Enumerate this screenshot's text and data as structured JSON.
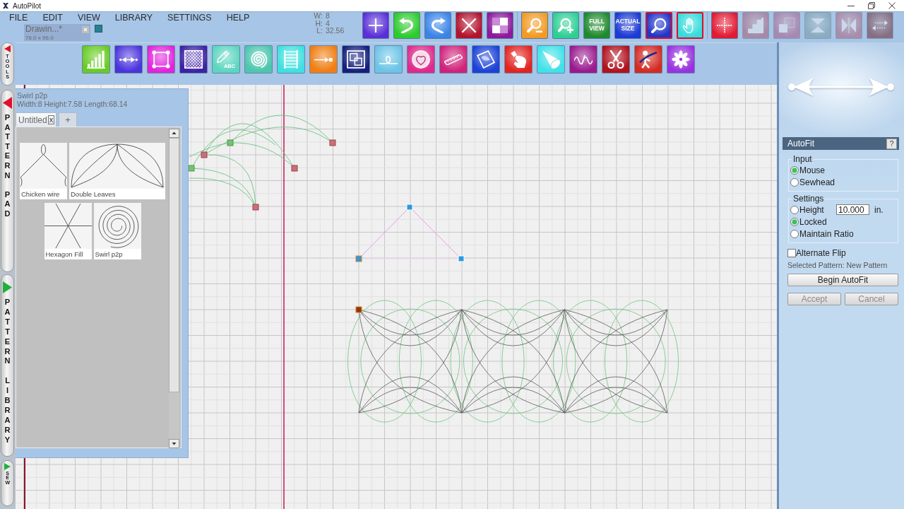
{
  "window": {
    "title": "AutoPilot"
  },
  "menu": [
    "FILE",
    "EDIT",
    "VIEW",
    "LIBRARY",
    "SETTINGS",
    "HELP"
  ],
  "document_tab": {
    "title": "Drawin...*",
    "size": "76.0 x 96.0"
  },
  "readings": [
    {
      "label": "W:",
      "value": "8"
    },
    {
      "label": "H:",
      "value": "4"
    },
    {
      "label": "L:",
      "value": "32.56"
    }
  ],
  "toolbar": {
    "groups": [
      {
        "items": [
          {
            "kind": "icon",
            "active": false,
            "disabled": false
          },
          {
            "kind": "icon",
            "active": false,
            "disabled": false
          },
          {
            "kind": "icon",
            "active": false,
            "disabled": false
          },
          {
            "kind": "icon",
            "active": false,
            "disabled": false
          },
          {
            "kind": "icon",
            "active": false,
            "disabled": false
          }
        ]
      },
      {
        "items": [
          {
            "kind": "icon",
            "active": false,
            "disabled": false
          },
          {
            "kind": "icon",
            "active": false,
            "disabled": false
          },
          {
            "kind": "text",
            "label": "FULL VIEW",
            "active": false,
            "disabled": false
          },
          {
            "kind": "text",
            "label": "ACTUAL SIZE",
            "active": false,
            "disabled": false
          },
          {
            "kind": "icon",
            "active": true,
            "disabled": false
          },
          {
            "kind": "icon",
            "active": true,
            "disabled": false
          }
        ]
      },
      {
        "items": [
          {
            "kind": "icon",
            "active": false,
            "disabled": false
          },
          {
            "kind": "icon",
            "active": false,
            "disabled": true
          },
          {
            "kind": "icon",
            "active": false,
            "disabled": true
          },
          {
            "kind": "icon",
            "active": false,
            "disabled": true
          },
          {
            "kind": "icon",
            "active": false,
            "disabled": true
          },
          {
            "kind": "icon",
            "active": false,
            "disabled": true
          }
        ]
      }
    ]
  },
  "tools": [
    {
      "kind": "icon"
    },
    {
      "kind": "icon"
    },
    {
      "kind": "icon"
    },
    {
      "kind": "icon"
    },
    {
      "kind": "icon_text",
      "label": "ABC"
    },
    {
      "kind": "icon"
    },
    {
      "kind": "icon"
    },
    {
      "kind": "icon"
    },
    {
      "kind": "icon"
    },
    {
      "kind": "icon"
    },
    {
      "kind": "icon"
    },
    {
      "kind": "icon"
    },
    {
      "kind": "icon"
    },
    {
      "kind": "icon"
    },
    {
      "kind": "icon"
    },
    {
      "kind": "icon"
    },
    {
      "kind": "icon"
    },
    {
      "kind": "icon"
    },
    {
      "kind": "icon"
    }
  ],
  "side_tabs": [
    {
      "label": "TOOLS",
      "expanded": true
    },
    {
      "label": "PATTERN PAD",
      "expanded": true
    },
    {
      "label": "PATTERN LIBRARY",
      "expanded": false
    },
    {
      "label": "SEW",
      "expanded": false
    }
  ],
  "pattern_pad": {
    "pattern_name": "Swirl p2p",
    "dimensions": "Width:8 Height:7.58 Length:68.14",
    "tabs": [
      {
        "label": "Untitled",
        "selected": true,
        "close": "x"
      },
      {
        "label": "+",
        "selected": false
      }
    ],
    "patterns": [
      "Chicken wire",
      "Double Leaves",
      "Hexagon Fill",
      "Swirl p2p"
    ]
  },
  "autofit": {
    "title": "AutoFit",
    "help": "?",
    "input": {
      "legend": "Input",
      "options": [
        {
          "label": "Mouse",
          "selected": true
        },
        {
          "label": "Sewhead",
          "selected": false
        }
      ]
    },
    "settings": {
      "legend": "Settings",
      "options": [
        {
          "kind": "radio_field",
          "label": "Height",
          "selected": false,
          "value": "10.000",
          "unit": "in."
        },
        {
          "kind": "radio",
          "label": "Locked",
          "selected": true
        },
        {
          "kind": "radio",
          "label": "Maintain Ratio",
          "selected": false
        }
      ]
    },
    "alternate_flip": {
      "label": "Alternate Flip",
      "checked": false
    },
    "selected_pattern": "Selected Pattern: New Pattern",
    "buttons": [
      {
        "label": "Begin AutoFit",
        "disabled": false
      },
      {
        "label": "Accept",
        "disabled": true
      },
      {
        "label": "Cancel",
        "disabled": true
      }
    ]
  }
}
